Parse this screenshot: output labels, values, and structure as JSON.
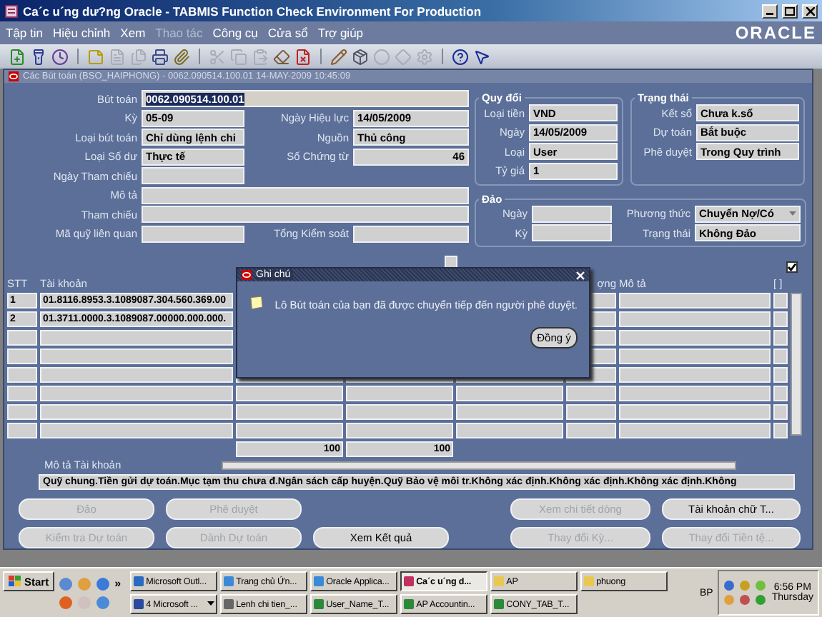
{
  "window": {
    "title": "Ca´c u´ng dư?ng Oracle - TABMIS Function Check Environment For Production"
  },
  "menu": [
    {
      "label": "Tập tin",
      "disabled": false
    },
    {
      "label": "Hiệu chỉnh",
      "disabled": false
    },
    {
      "label": "Xem",
      "disabled": false
    },
    {
      "label": "Thao tác",
      "disabled": true
    },
    {
      "label": "Công cụ",
      "disabled": false
    },
    {
      "label": "Cửa sổ",
      "disabled": false
    },
    {
      "label": "Trợ giúp",
      "disabled": false
    }
  ],
  "logo": "ORACLE",
  "toolbar": [
    {
      "kind": "new",
      "disabled": false
    },
    {
      "kind": "find",
      "disabled": false
    },
    {
      "kind": "clock",
      "disabled": false
    },
    {
      "kind": "separator"
    },
    {
      "kind": "note",
      "disabled": false
    },
    {
      "kind": "document",
      "disabled": true
    },
    {
      "kind": "files",
      "disabled": true
    },
    {
      "kind": "print",
      "disabled": false
    },
    {
      "kind": "attach",
      "disabled": false
    },
    {
      "kind": "separator"
    },
    {
      "kind": "cut",
      "disabled": true
    },
    {
      "kind": "copy",
      "disabled": true
    },
    {
      "kind": "paste",
      "disabled": true
    },
    {
      "kind": "clear",
      "disabled": false
    },
    {
      "kind": "delete",
      "disabled": false
    },
    {
      "kind": "separator"
    },
    {
      "kind": "edit",
      "disabled": false
    },
    {
      "kind": "box",
      "disabled": false
    },
    {
      "kind": "circle",
      "disabled": true
    },
    {
      "kind": "diamond",
      "disabled": true
    },
    {
      "kind": "gear",
      "disabled": true
    },
    {
      "kind": "separator"
    },
    {
      "kind": "help",
      "disabled": false
    },
    {
      "kind": "pointer_help",
      "disabled": false
    }
  ],
  "form_window": {
    "title": "Các Bút toán (BSO_HAIPHONG) - 0062.090514.100.01 14-MAY-2009 10:45:09"
  },
  "header_rows": [
    {
      "kind": "full",
      "field": {
        "label": "Bút toán",
        "value": "0062.090514.100.01",
        "highlighted": true
      }
    },
    {
      "kind": "pair",
      "left": {
        "label": "Kỳ",
        "value": "05-09"
      },
      "right": {
        "label": "Ngày Hiệu lực",
        "value": "14/05/2009"
      }
    },
    {
      "kind": "pair",
      "left": {
        "label": "Loại bút toán",
        "value": "Chỉ dùng lệnh chi"
      },
      "right": {
        "label": "Nguồn",
        "value": "Thủ công"
      }
    },
    {
      "kind": "pair",
      "left": {
        "label": "Loại Số dư",
        "value": "Thực tế"
      },
      "right": {
        "label": "Số Chứng từ",
        "value": "46",
        "numeric": true
      }
    },
    {
      "kind": "pair",
      "left": {
        "label": "Ngày Tham chiếu"
      }
    },
    {
      "kind": "full",
      "field": {
        "label": "Mô tả"
      }
    },
    {
      "kind": "full",
      "field": {
        "label": "Tham chiếu"
      }
    },
    {
      "kind": "pair",
      "left": {
        "label": "Mã quỹ liên quan"
      },
      "right": {
        "label": "Tổng Kiểm soát"
      }
    }
  ],
  "conversion": {
    "title": "Quy đổi",
    "fields": [
      {
        "label": "Loại tiền",
        "value": "VND"
      },
      {
        "label": "Ngày",
        "value": "14/05/2009"
      },
      {
        "label": "Loại",
        "value": "User"
      },
      {
        "label": "Tỷ giá",
        "value": "1"
      }
    ]
  },
  "status": {
    "title": "Trạng thái",
    "fields": [
      {
        "label": "Kết sổ",
        "value": "Chưa k.sổ"
      },
      {
        "label": "Dự toán",
        "value": "Bắt buộc"
      },
      {
        "label": "Phê duyệt",
        "value": "Trong Quy trình"
      }
    ]
  },
  "reversal": {
    "title": "Đảo",
    "fields": [
      {
        "label": "Ngày"
      },
      {
        "label": "Kỳ"
      },
      {
        "label": "Phương thức",
        "value": "Chuyển Nợ/Có",
        "kind": "dropdown"
      },
      {
        "label": "Trạng thái",
        "value": "Không Đảo"
      }
    ]
  },
  "lines_checkbox": {
    "checked": true
  },
  "lines": {
    "columns": [
      "STT",
      "Tài khoản",
      "ợng",
      "Mô tả",
      "[ ]"
    ],
    "rows": [
      {
        "cells": [
          "1",
          "01.8116.8953.3.1089087.304.560.369.00"
        ]
      },
      {
        "cells": [
          "2",
          "01.3711.0000.3.1089087.00000.000.000."
        ]
      }
    ],
    "totals": [
      "100",
      "100"
    ]
  },
  "account_description": {
    "label": "Mô tả Tài khoản",
    "value": "Quỹ chung.Tiền gửi dự toán.Mục tạm thu chưa đ.Ngân sách cấp huyện.Quỹ Bảo vệ môi tr.Không xác định.Không xác định.Không xác định.Không"
  },
  "button_rows": [
    [
      {
        "label": "Đảo",
        "disabled": true
      },
      {
        "label": "Phê duyệt",
        "disabled": true
      },
      {
        "label": "Xem chi tiết dòng",
        "disabled": true
      },
      {
        "label": "Tài khoản chữ T...",
        "disabled": false
      }
    ],
    [
      {
        "label": "Kiểm tra Dự toán",
        "disabled": true
      },
      {
        "label": "Dành Dự toán",
        "disabled": true
      },
      {
        "label": "Xem Kết quả",
        "disabled": false
      },
      {
        "label": "Thay đổi Kỳ...",
        "disabled": true
      },
      {
        "label": "Thay đổi Tiền tệ...",
        "disabled": true
      }
    ]
  ],
  "dialog": {
    "title": "Ghi chú",
    "message": "Lô Bút toán của bạn đã được chuyển tiếp đến người phê duyệt.",
    "button": "Đồng ý"
  },
  "taskbar": {
    "start": "Start",
    "chevron": "»",
    "tray_label": "BP",
    "time": "6:56 PM",
    "day": "Thursday",
    "tasks": [
      {
        "label": "Microsoft Outl...",
        "kind": "mail",
        "active": false
      },
      {
        "label": "Trang chủ Ứn...",
        "kind": "browser",
        "active": false
      },
      {
        "label": "Oracle Applica...",
        "kind": "browser",
        "active": false
      },
      {
        "label": "Ca´c u´ng d...",
        "kind": "oracle",
        "active": true
      },
      {
        "label": "AP",
        "kind": "folder",
        "active": false
      },
      {
        "label": "phuong",
        "kind": "folder",
        "active": false
      },
      {
        "label": "4 Microsoft ...",
        "kind": "word",
        "active": false,
        "group": true
      },
      {
        "label": "Lenh chi tien_...",
        "kind": "document",
        "active": false
      },
      {
        "label": "User_Name_T...",
        "kind": "sheet",
        "active": false
      },
      {
        "label": "AP Accountin...",
        "kind": "sheet",
        "active": false
      },
      {
        "label": "CONY_TAB_T...",
        "kind": "sheet",
        "active": false
      }
    ]
  }
}
